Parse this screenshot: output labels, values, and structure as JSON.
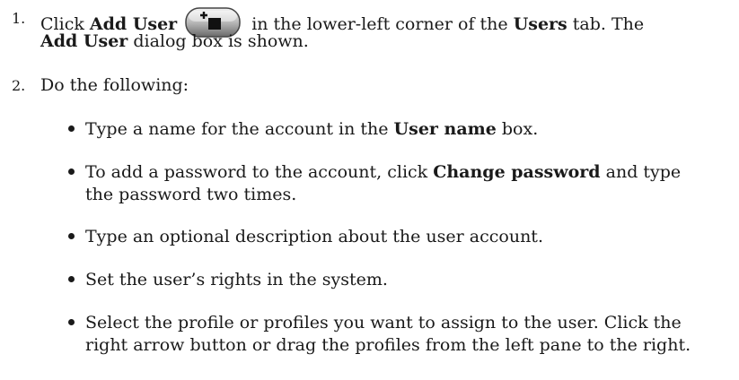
{
  "steps": [
    {
      "number": "1.",
      "pre": "Click ",
      "b1": "Add User",
      "icon": "add-user-icon",
      "mid": "in the lower-left corner of the ",
      "b2": "Users",
      "post": " tab. The",
      "line2_b": "Add User",
      "line2_post": " dialog box is shown."
    },
    {
      "number": "2.",
      "text": "Do the following:"
    }
  ],
  "bullets": [
    {
      "pre": "Type a name for the account in the ",
      "bold": "User name",
      "post": " box."
    },
    {
      "pre": "To add a password to the account, click ",
      "bold": "Change password",
      "post": " and type",
      "line2": "the password two times."
    },
    {
      "text": "Type an optional description about the user account."
    },
    {
      "text": "Set the user’s rights in the system."
    },
    {
      "line1": "Select the profile or profiles you want to assign to the user. Click the",
      "line2": "right arrow button or drag the profiles from the left pane to the right."
    }
  ]
}
